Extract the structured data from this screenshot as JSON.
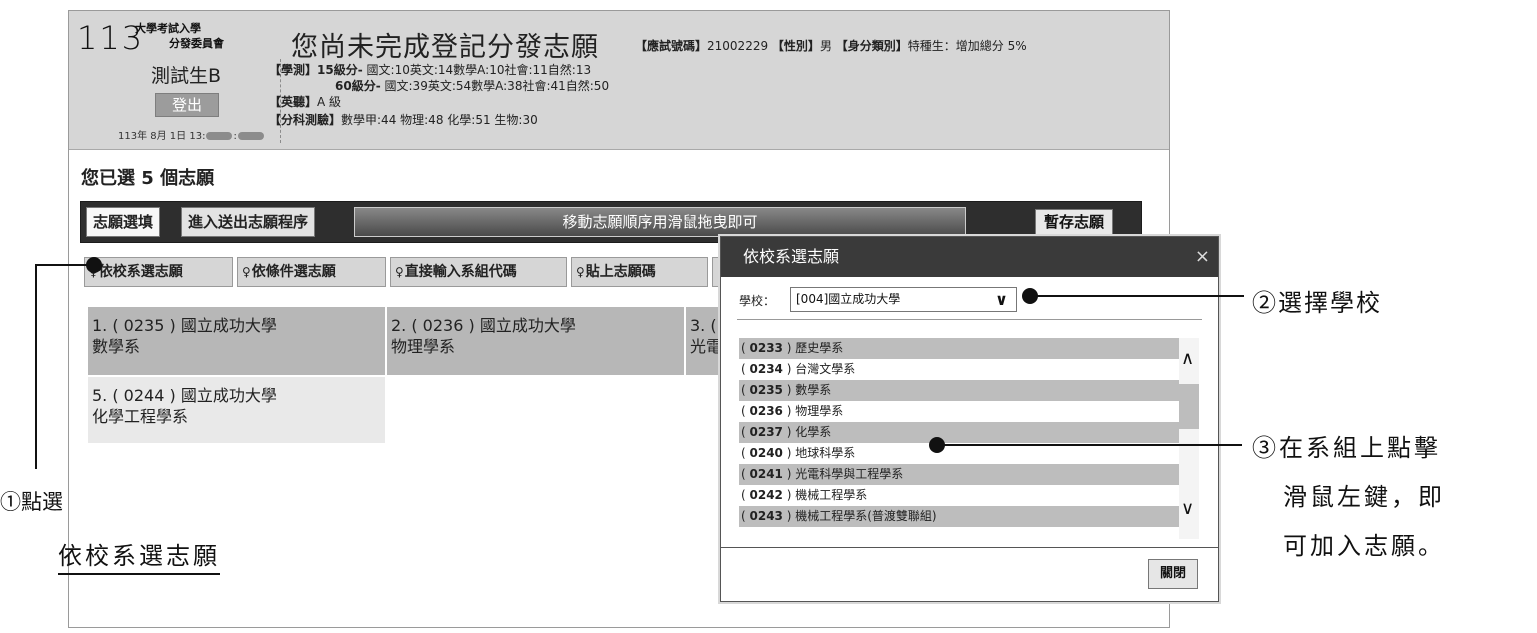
{
  "header": {
    "logo_number": "113",
    "logo_org_line1": "大學考試入學",
    "logo_org_line2": "分發委員會",
    "username": "測試生B",
    "logout_label": "登出",
    "timestamp_prefix": "113年 8月 1日 13:",
    "page_title": "您尚未完成登記分發志願",
    "exam_no_label": "【應試號碼】",
    "exam_no": "21002229",
    "gender_label": "【性別】",
    "gender": "男",
    "identity_label": "【身分類別】",
    "identity": "特種生：增加總分 5%",
    "gsat_label": "【學測】",
    "gsat15_label": "15級分-",
    "gsat15_scores": "國文:10英文:14數學A:10社會:11自然:13",
    "gsat60_label": "60級分-",
    "gsat60_scores": "國文:39英文:54數學A:38社會:41自然:50",
    "english_label": "【英聽】",
    "english_level": "A 級",
    "ast_label": "【分科測驗】",
    "ast_scores": "數學甲:44 物理:48 化學:51 生物:30"
  },
  "summary": {
    "prefix": "您已選 ",
    "count": "5",
    "suffix": " 個志願"
  },
  "toolbar": {
    "tab_fill": "志願選填",
    "tab_submit": "進入送出志願程序",
    "drag_hint": "移動志願順序用滑鼠拖曳即可",
    "save_label": "暫存志願"
  },
  "modes": {
    "by_school": "依校系選志願",
    "by_condition": "依條件選志願",
    "by_code": "直接輸入系組代碼",
    "paste": "貼上志願碼"
  },
  "choices": [
    {
      "line1": "1. ( 0235 ) 國立成功大學",
      "line2": "數學系"
    },
    {
      "line1": "2. ( 0236 ) 國立成功大學",
      "line2": "物理學系"
    },
    {
      "line1": "3. (",
      "line2": "光電"
    },
    {
      "line1": "5. ( 0244 ) 國立成功大學",
      "line2": "化學工程學系"
    }
  ],
  "dialog": {
    "title": "依校系選志願",
    "close_x": "×",
    "school_label": "學校：",
    "school_value": "[004]國立成功大學",
    "departments": [
      {
        "code": "0233",
        "name": "歷史學系"
      },
      {
        "code": "0234",
        "name": "台灣文學系"
      },
      {
        "code": "0235",
        "name": "數學系"
      },
      {
        "code": "0236",
        "name": "物理學系"
      },
      {
        "code": "0237",
        "name": "化學系"
      },
      {
        "code": "0240",
        "name": "地球科學系"
      },
      {
        "code": "0241",
        "name": "光電科學與工程學系"
      },
      {
        "code": "0242",
        "name": "機械工程學系"
      },
      {
        "code": "0243",
        "name": "機械工程學系(普渡雙聯組)"
      }
    ],
    "close_button": "關閉"
  },
  "annotations": {
    "step1_line1": "①點選",
    "step1_line2": "依校系選志願",
    "step2": "②選擇學校",
    "step3_line1": "③在系組上點擊",
    "step3_line2": "滑鼠左鍵，即",
    "step3_line3": "可加入志願。"
  },
  "colors": {
    "header_bg": "#d6d6d6",
    "toolbar_bg": "#2e2e2e",
    "dialog_head": "#3a3a3a"
  }
}
